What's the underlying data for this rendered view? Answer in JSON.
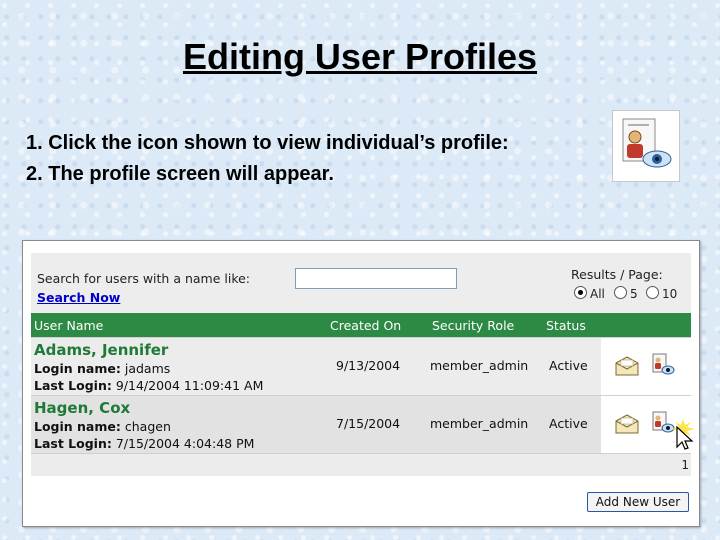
{
  "slide": {
    "title": "Editing User Profiles",
    "steps": [
      "1. Click the icon shown to view individual’s profile:",
      "2. The profile screen will appear."
    ]
  },
  "search": {
    "label": "Search for users with a name like:",
    "input_value": "",
    "link": "Search Now"
  },
  "results_per_page": {
    "label": "Results / Page:",
    "options": [
      "All",
      "5",
      "10"
    ],
    "selected": "All"
  },
  "table": {
    "headers": {
      "user_name": "User Name",
      "created_on": "Created On",
      "security_role": "Security Role",
      "status": "Status"
    },
    "login_label": "Login name:",
    "last_login_label": "Last Login:",
    "rows": [
      {
        "name": "Adams, Jennifer",
        "login": "jadams",
        "last_login": "9/14/2004 11:09:41 AM",
        "created_on": "9/13/2004",
        "role": "member_admin",
        "status": "Active"
      },
      {
        "name": "Hagen, Cox",
        "login": "chagen",
        "last_login": "7/15/2004 4:04:48 PM",
        "created_on": "7/15/2004",
        "role": "member_admin",
        "status": "Active"
      }
    ]
  },
  "pagination": {
    "page": "1"
  },
  "add_user_button": "Add New User",
  "icons": {
    "profile": "view-profile-icon",
    "email": "envelope-icon",
    "cursor": "mouse-pointer-icon"
  }
}
